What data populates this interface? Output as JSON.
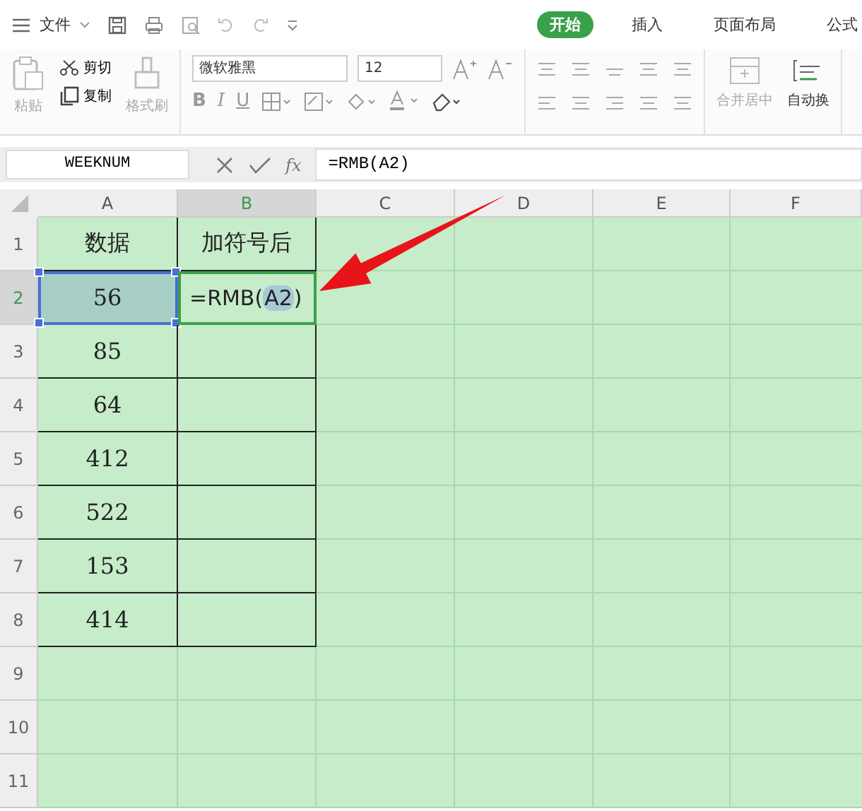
{
  "menu": {
    "file": "文件"
  },
  "tabs": [
    {
      "label": "开始",
      "selected": true
    },
    {
      "label": "插入",
      "selected": false
    },
    {
      "label": "页面布局",
      "selected": false
    },
    {
      "label": "公式",
      "selected": false
    }
  ],
  "ribbon": {
    "paste": "粘贴",
    "cut": "剪切",
    "copy": "复制",
    "format_painter": "格式刷",
    "font": "微软雅黑",
    "font_size": "12",
    "bold": "B",
    "italic": "I",
    "underline": "U",
    "merge": "合并居中",
    "wrap": "自动换"
  },
  "formula_bar": {
    "name_box": "WEEKNUM",
    "fx": "fx",
    "formula": "=RMB(A2)"
  },
  "columns": [
    {
      "label": "A",
      "selected": false
    },
    {
      "label": "B",
      "selected": true
    },
    {
      "label": "C",
      "selected": false
    },
    {
      "label": "D",
      "selected": false
    },
    {
      "label": "E",
      "selected": false
    },
    {
      "label": "F",
      "selected": false
    }
  ],
  "rows": [
    {
      "number": "1",
      "selected": false,
      "cells": [
        {
          "kind": "value",
          "text": "数据"
        },
        {
          "kind": "header",
          "text": "加符号后"
        }
      ]
    },
    {
      "number": "2",
      "selected": true,
      "cells": [
        {
          "kind": "ref",
          "text": "56"
        },
        {
          "kind": "formula",
          "text": "=RMB(",
          "ref": "A2",
          "tail": ")"
        }
      ]
    },
    {
      "number": "3",
      "selected": false,
      "cells": [
        {
          "kind": "value",
          "text": "85"
        },
        {
          "kind": "empty"
        }
      ]
    },
    {
      "number": "4",
      "selected": false,
      "cells": [
        {
          "kind": "value",
          "text": "64"
        },
        {
          "kind": "empty"
        }
      ]
    },
    {
      "number": "5",
      "selected": false,
      "cells": [
        {
          "kind": "value",
          "text": "412"
        },
        {
          "kind": "empty"
        }
      ]
    },
    {
      "number": "6",
      "selected": false,
      "cells": [
        {
          "kind": "value",
          "text": "522"
        },
        {
          "kind": "empty"
        }
      ]
    },
    {
      "number": "7",
      "selected": false,
      "cells": [
        {
          "kind": "value",
          "text": "153"
        },
        {
          "kind": "empty"
        }
      ]
    },
    {
      "number": "8",
      "selected": false,
      "cells": [
        {
          "kind": "value",
          "text": "414"
        },
        {
          "kind": "empty"
        }
      ]
    },
    {
      "number": "9",
      "selected": false,
      "cells": []
    },
    {
      "number": "10",
      "selected": false,
      "cells": []
    },
    {
      "number": "11",
      "selected": false,
      "cells": []
    }
  ]
}
